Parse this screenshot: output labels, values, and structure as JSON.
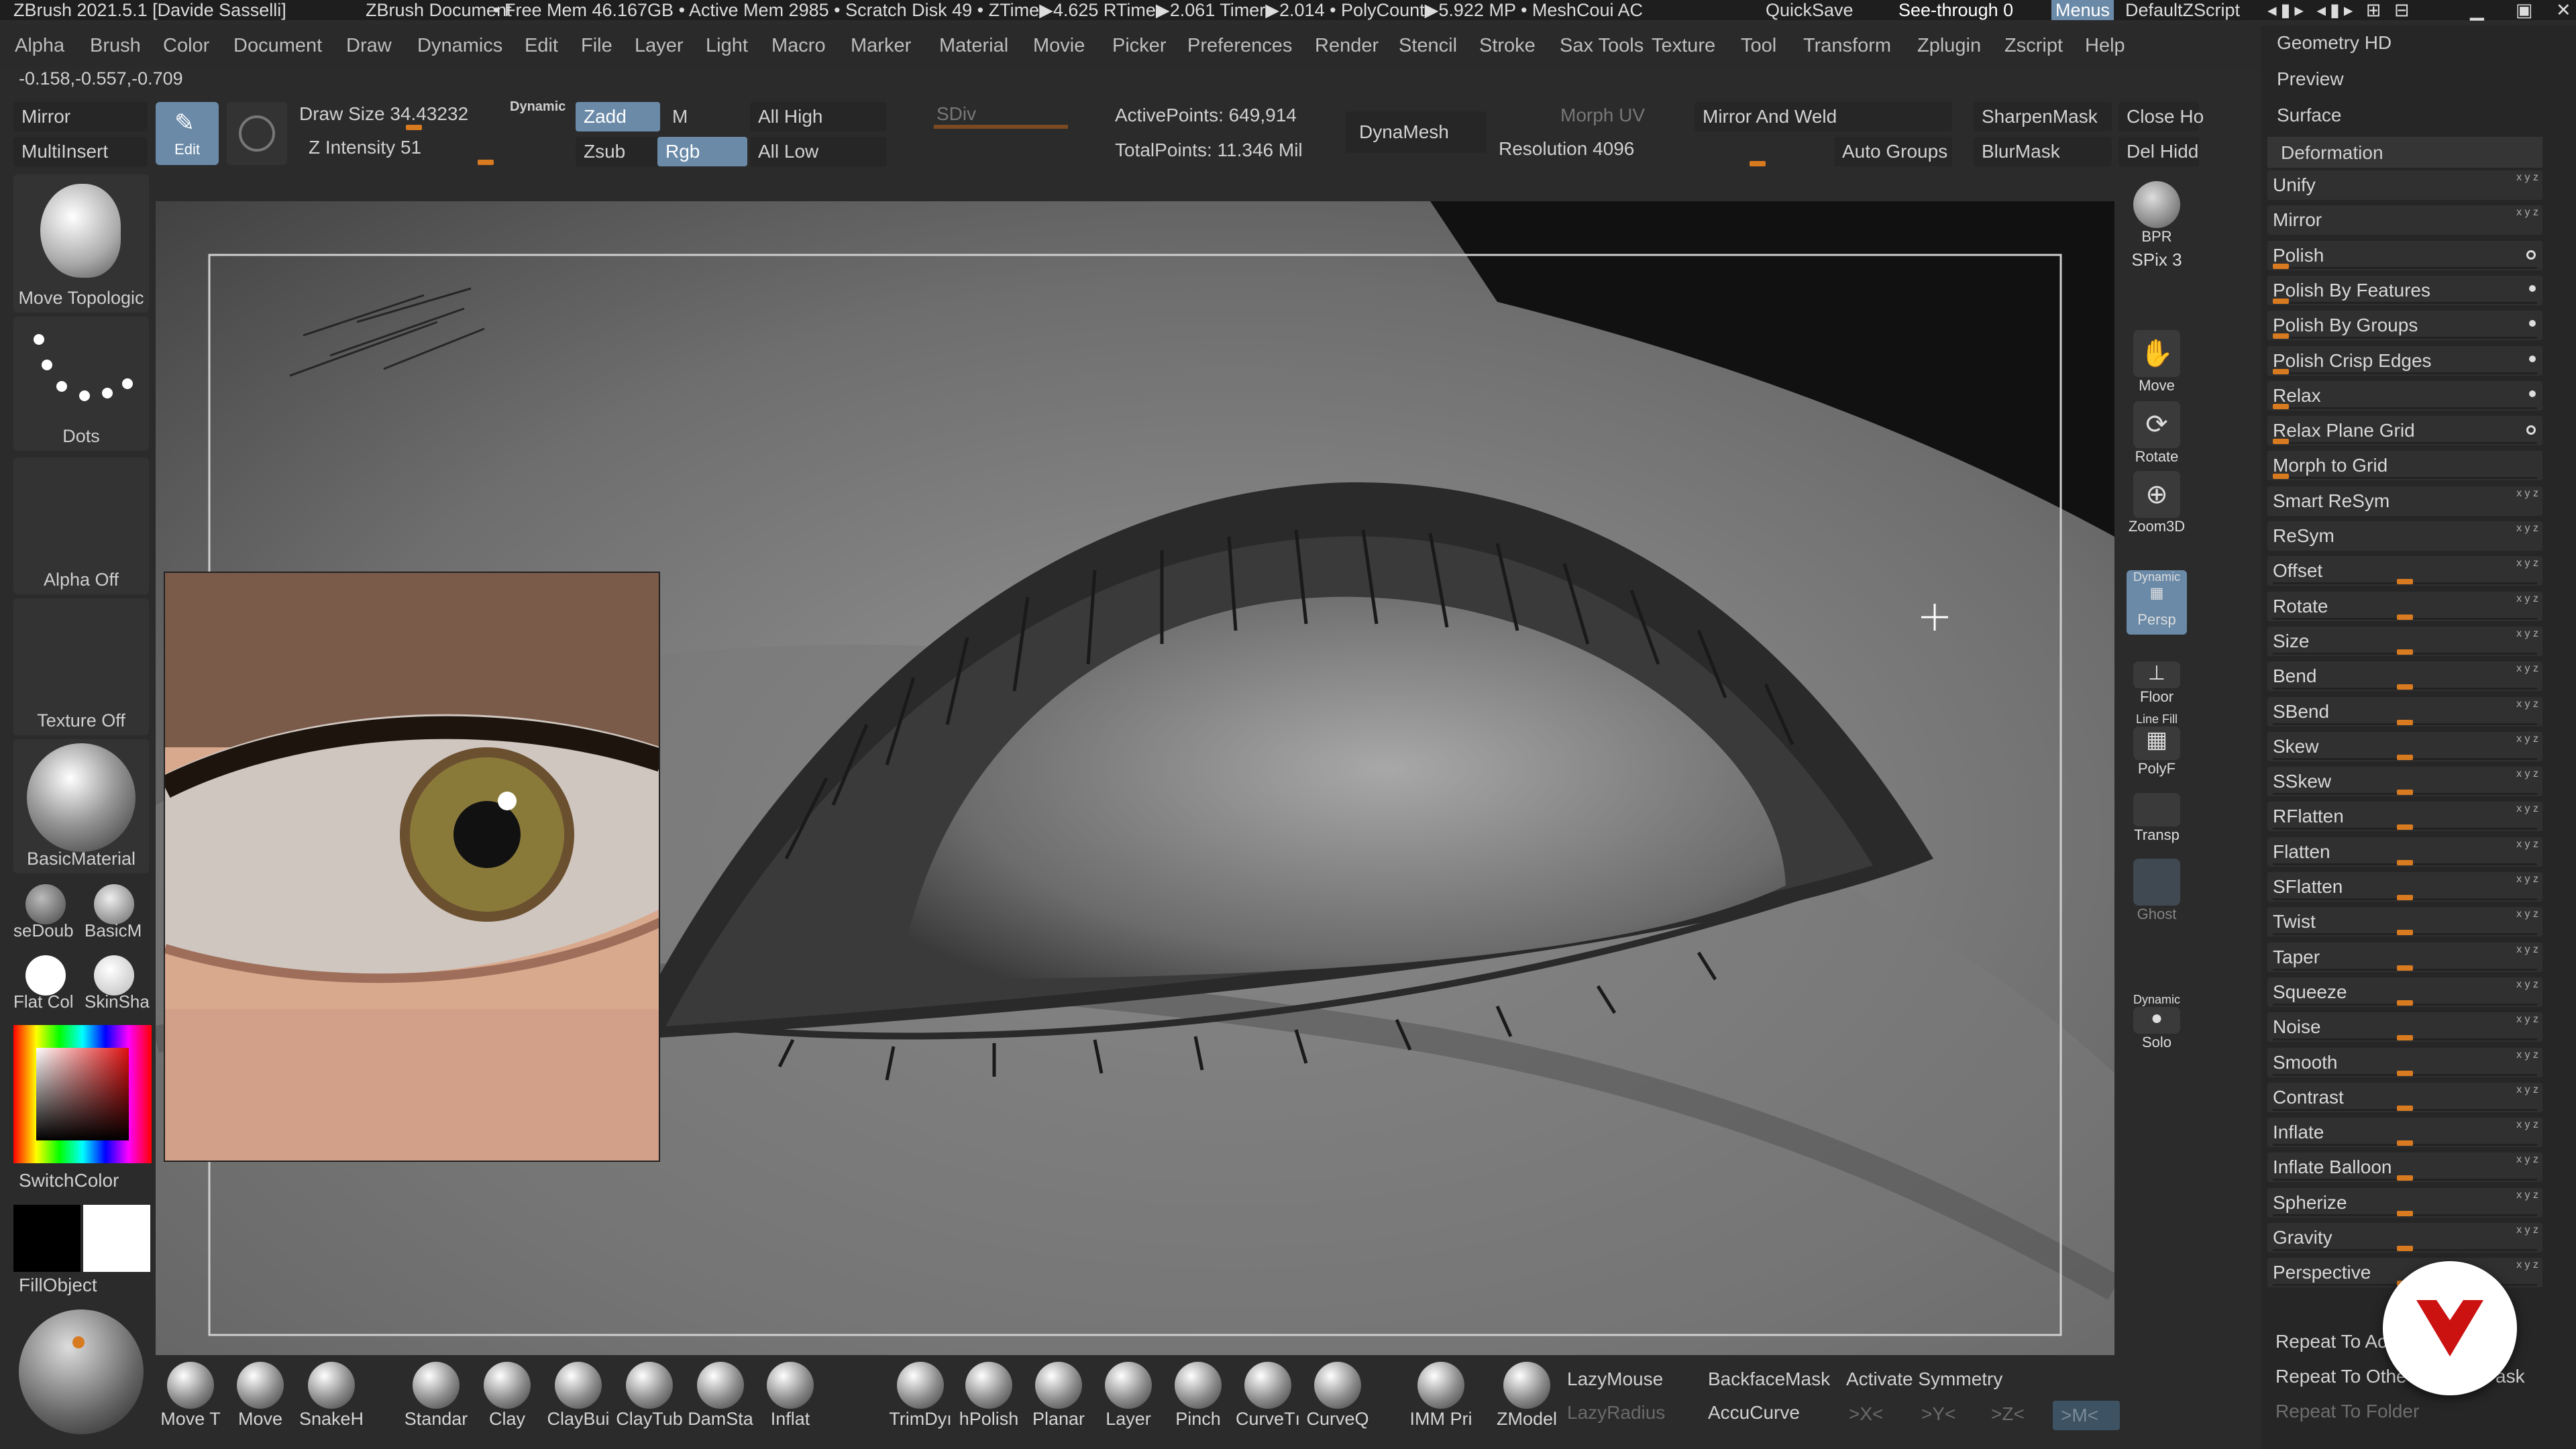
{
  "titlebar": {
    "app": "ZBrush 2021.5.1 [Davide Sasselli]",
    "doc": "ZBrush Document",
    "stats": "• Free Mem 46.167GB • Active Mem 2985 • Scratch Disk 49 • ZTime▶4.625 RTime▶2.061 Timer▶2.014 • PolyCount▶5.922 MP • MeshCoui AC",
    "quicksave": "QuickSave",
    "seethrough": "See-through 0",
    "menus": "Menus",
    "script": "DefaultZScript"
  },
  "menu": [
    "Alpha",
    "Brush",
    "Color",
    "Document",
    "Draw",
    "Dynamics",
    "Edit",
    "File",
    "Layer",
    "Light",
    "Macro",
    "Marker",
    "Material",
    "Movie",
    "Picker",
    "Preferences",
    "Render",
    "Stencil",
    "Stroke",
    "Sax Tools",
    "Texture",
    "Tool",
    "Transform",
    "Zplugin",
    "Zscript",
    "Help"
  ],
  "coords": "-0.158,-0.557,-0.709",
  "toptools": {
    "mirror": "Mirror",
    "multiinsert": "MultiInsert",
    "edit": "Edit",
    "drawsize": "Draw Size 34.43232",
    "dynamic": "Dynamic",
    "zintensity": "Z Intensity 51",
    "zadd": "Zadd",
    "m": "M",
    "zsub": "Zsub",
    "rgb": "Rgb",
    "allhigh": "All High",
    "alllow": "All Low",
    "sdiv": "SDiv",
    "activepoints": "ActivePoints: 649,914",
    "totalpoints": "TotalPoints: 11.346 Mil",
    "dynamesh": "DynaMesh",
    "morphuv": "Morph UV",
    "resolution": "Resolution 4096",
    "mirrorweld": "Mirror And Weld",
    "autogroups": "Auto Groups",
    "sharpenmask": "SharpenMask",
    "blurmask": "BlurMask",
    "closeho": "Close Ho",
    "delhidd": "Del Hidd"
  },
  "leftshelf": {
    "brush": "Move Topologic",
    "stroke": "Dots",
    "alpha": "Alpha Off",
    "texture": "Texture Off",
    "material": "BasicMaterial",
    "mat1": "seDoub",
    "mat2": "BasicM",
    "mat3": "Flat Col",
    "mat4": "SkinSha",
    "switchcolor": "SwitchColor",
    "fillobject": "FillObject"
  },
  "rightshelf": {
    "bpr": "BPR",
    "spix": "SPix 3",
    "move": "Move",
    "rotate": "Rotate",
    "zoom": "Zoom3D",
    "persp": "Persp",
    "perspdyn": "Dynamic",
    "floor": "Floor",
    "linefill": "Line Fill",
    "polyf": "PolyF",
    "transp": "Transp",
    "ghost": "Ghost",
    "solo": "Solo",
    "solodyn": "Dynamic"
  },
  "panel": {
    "geometry": "Geometry HD",
    "preview": "Preview",
    "surface": "Surface",
    "deformation": "Deformation",
    "rows": [
      {
        "name": "Unify",
        "type": "axes"
      },
      {
        "name": "Mirror",
        "type": "axes"
      },
      {
        "name": "Polish",
        "type": "ring",
        "value": 0.03
      },
      {
        "name": "Polish By Features",
        "type": "dot",
        "value": 0.03
      },
      {
        "name": "Polish By Groups",
        "type": "dot",
        "value": 0.03
      },
      {
        "name": "Polish Crisp Edges",
        "type": "dot",
        "value": 0.03
      },
      {
        "name": "Relax",
        "type": "dot",
        "value": 0.03
      },
      {
        "name": "Relax Plane Grid",
        "type": "ring",
        "value": 0.03
      },
      {
        "name": "Morph to Grid",
        "type": "none",
        "value": 0.03
      },
      {
        "name": "Smart ReSym",
        "type": "axes"
      },
      {
        "name": "ReSym",
        "type": "axes"
      },
      {
        "name": "Offset",
        "type": "axes",
        "value": 0.5
      },
      {
        "name": "Rotate",
        "type": "axes",
        "value": 0.5
      },
      {
        "name": "Size",
        "type": "axes",
        "value": 0.5
      },
      {
        "name": "Bend",
        "type": "axes",
        "value": 0.5
      },
      {
        "name": "SBend",
        "type": "axes",
        "value": 0.5
      },
      {
        "name": "Skew",
        "type": "axes",
        "value": 0.5
      },
      {
        "name": "SSkew",
        "type": "axes",
        "value": 0.5
      },
      {
        "name": "RFlatten",
        "type": "axes",
        "value": 0.5
      },
      {
        "name": "Flatten",
        "type": "axes",
        "value": 0.5
      },
      {
        "name": "SFlatten",
        "type": "axes",
        "value": 0.5
      },
      {
        "name": "Twist",
        "type": "axes",
        "value": 0.5
      },
      {
        "name": "Taper",
        "type": "axes",
        "value": 0.5
      },
      {
        "name": "Squeeze",
        "type": "axes",
        "value": 0.5
      },
      {
        "name": "Noise",
        "type": "axes",
        "value": 0.5
      },
      {
        "name": "Smooth",
        "type": "axes",
        "value": 0.5
      },
      {
        "name": "Contrast",
        "type": "axes",
        "value": 0.5
      },
      {
        "name": "Inflate",
        "type": "axes",
        "value": 0.5
      },
      {
        "name": "Inflate Balloon",
        "type": "axes",
        "value": 0.5
      },
      {
        "name": "Spherize",
        "type": "axes",
        "value": 0.5
      },
      {
        "name": "Gravity",
        "type": "axes",
        "value": 0.5
      },
      {
        "name": "Perspective",
        "type": "axes",
        "value": 0.5
      }
    ],
    "repeat1": "Repeat To Ac",
    "repeat2": "Repeat To Othe",
    "repeat2b": "ask",
    "repeat3": "Repeat To Folder"
  },
  "bottom": {
    "brushes": [
      "Move T",
      "Move",
      "SnakeH",
      "Standar",
      "Clay",
      "ClayBui",
      "ClayTub",
      "DamSta",
      "Inflat",
      "TrimDyı",
      "hPolish",
      "Planar",
      "Layer",
      "Pinch",
      "CurveTı",
      "CurveQ",
      "IMM Pri",
      "ZModel"
    ],
    "lazymouse": "LazyMouse",
    "lazyradius": "LazyRadius",
    "backfacemask": "BackfaceMask",
    "accucurve": "AccuCurve",
    "activatesym": "Activate Symmetry",
    "x": ">X<",
    "y": ">Y<",
    "z": ">Z<",
    "m": ">M<"
  },
  "colors": {
    "accent": "#d87a20",
    "active": "#6a8aa8",
    "logo": "#cc1111"
  }
}
